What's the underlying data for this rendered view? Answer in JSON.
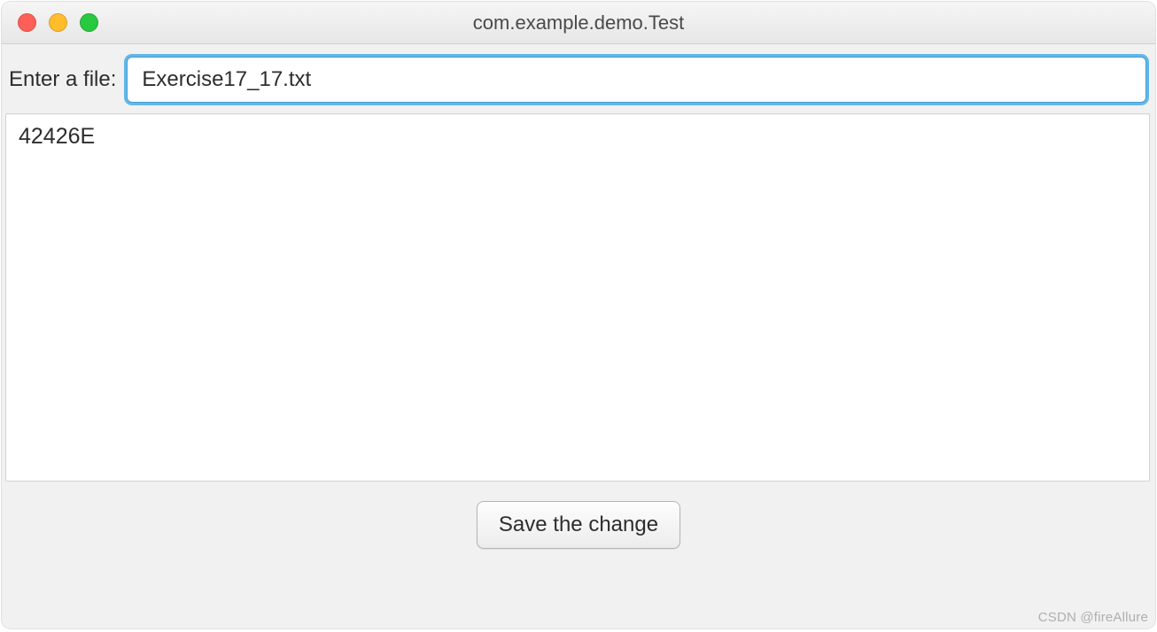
{
  "window": {
    "title": "com.example.demo.Test"
  },
  "form": {
    "file_label": "Enter a file:",
    "file_value": "Exercise17_17.txt",
    "content_value": "42426E",
    "save_label": "Save the change"
  },
  "watermark": "CSDN @fireAllure"
}
